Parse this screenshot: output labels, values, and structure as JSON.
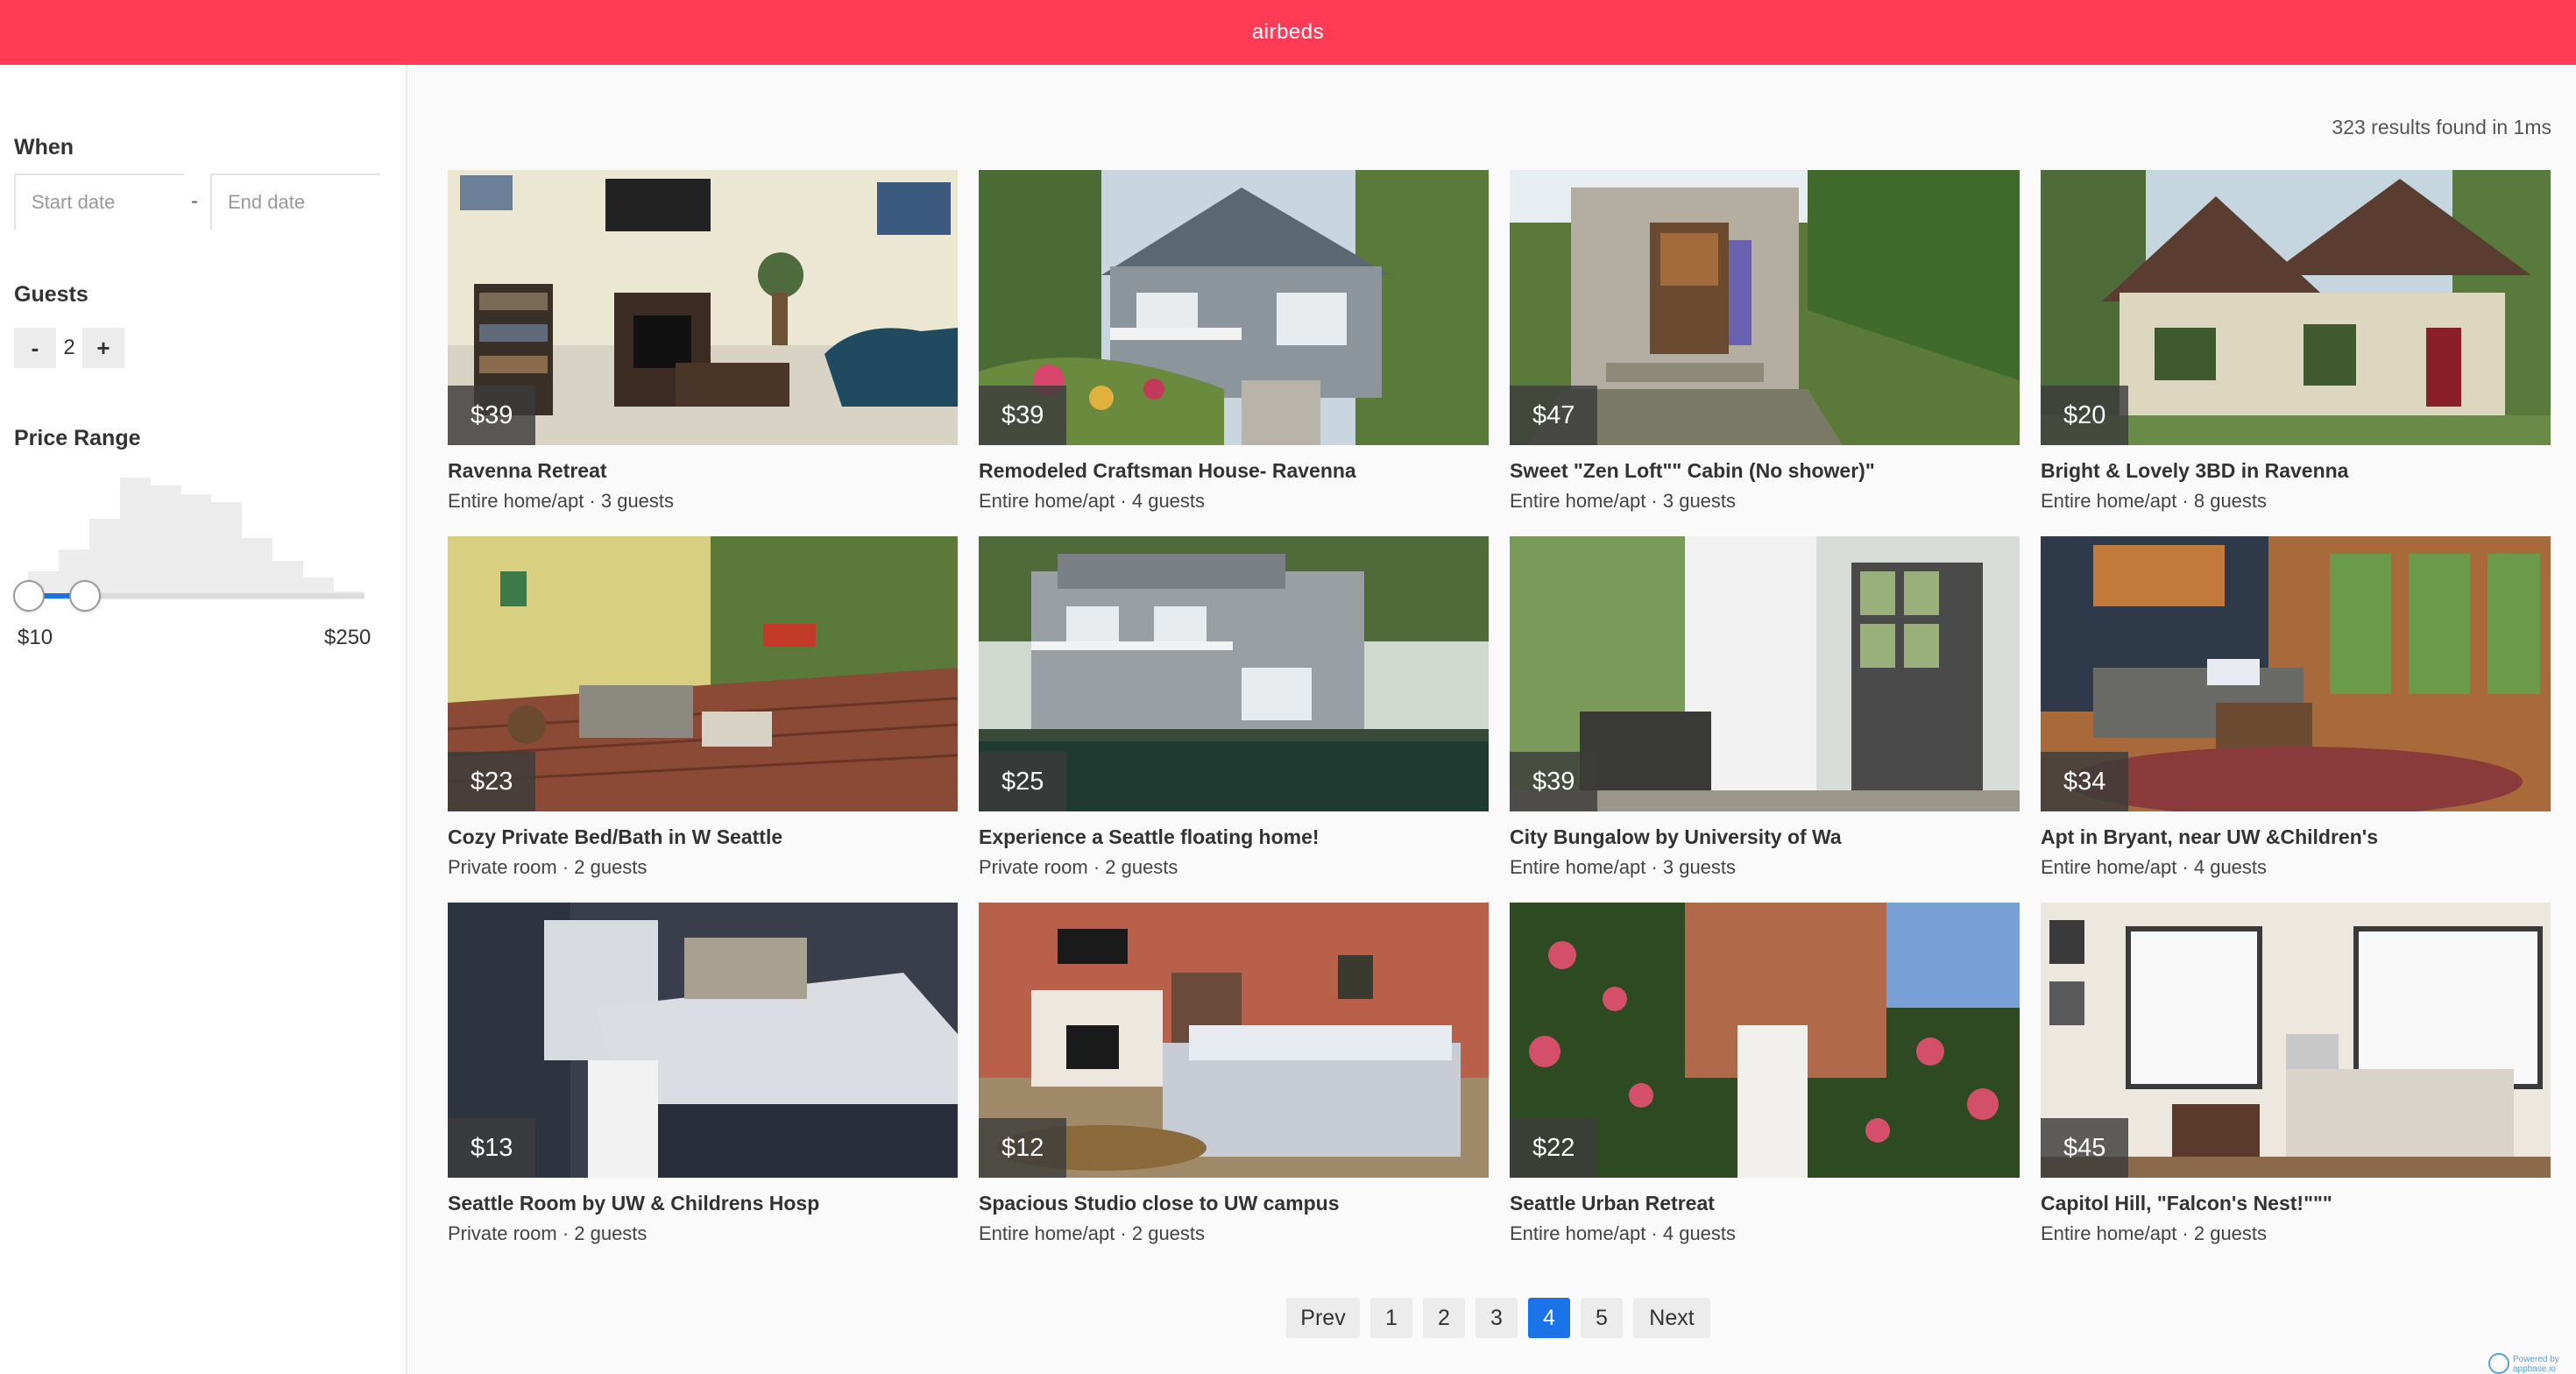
{
  "header": {
    "brand": "airbeds"
  },
  "filters": {
    "when": {
      "label": "When",
      "start_placeholder": "Start date",
      "end_placeholder": "End date",
      "separator": "-"
    },
    "guests": {
      "label": "Guests",
      "minus": "-",
      "value": "2",
      "plus": "+"
    },
    "price": {
      "label": "Price Range",
      "min_label": "$10",
      "max_label": "$250",
      "histogram": [
        0.2,
        0.36,
        0.58,
        0.88,
        0.82,
        0.76,
        0.7,
        0.44,
        0.28,
        0.16,
        0.06
      ]
    }
  },
  "results": {
    "count_text": "323 results found in 1ms"
  },
  "listings": [
    {
      "price": "$39",
      "title": "Ravenna Retreat",
      "meta": "Entire home/apt · 3 guests",
      "image": "living-room-photo"
    },
    {
      "price": "$39",
      "title": "Remodeled Craftsman House- Ravenna",
      "meta": "Entire home/apt · 4 guests",
      "image": "craftsman-house-photo"
    },
    {
      "price": "$47",
      "title": "Sweet \"Zen Loft\"\" Cabin (No shower)\"",
      "meta": "Entire home/apt · 3 guests",
      "image": "cabin-photo"
    },
    {
      "price": "$20",
      "title": "Bright & Lovely 3BD in Ravenna",
      "meta": "Entire home/apt · 8 guests",
      "image": "cottage-photo"
    },
    {
      "price": "$23",
      "title": "Cozy Private Bed/Bath in W Seattle",
      "meta": "Private room · 2 guests",
      "image": "deck-photo"
    },
    {
      "price": "$25",
      "title": "Experience a Seattle floating home!",
      "meta": "Private room · 2 guests",
      "image": "floating-home-photo"
    },
    {
      "price": "$39",
      "title": "City Bungalow by University of Wa",
      "meta": "Entire home/apt · 3 guests",
      "image": "porch-photo"
    },
    {
      "price": "$34",
      "title": "Apt in Bryant, near UW &Children's",
      "meta": "Entire home/apt · 4 guests",
      "image": "sunroom-photo"
    },
    {
      "price": "$13",
      "title": "Seattle Room by UW & Childrens Hosp",
      "meta": "Private room · 2 guests",
      "image": "bedroom-photo"
    },
    {
      "price": "$12",
      "title": "Spacious Studio close to UW campus",
      "meta": "Entire home/apt · 2 guests",
      "image": "studio-photo"
    },
    {
      "price": "$22",
      "title": "Seattle Urban Retreat",
      "meta": "Entire home/apt · 4 guests",
      "image": "roses-photo"
    },
    {
      "price": "$45",
      "title": "Capitol Hill, \"Falcon's Nest!\"\"\"",
      "meta": "Entire home/apt · 2 guests",
      "image": "lounge-photo"
    }
  ],
  "pagination": {
    "prev": "Prev",
    "pages": [
      "1",
      "2",
      "3",
      "4",
      "5"
    ],
    "current": "4",
    "next": "Next"
  },
  "footer": {
    "powered_by": "Powered by",
    "brand": "appbase.io"
  }
}
